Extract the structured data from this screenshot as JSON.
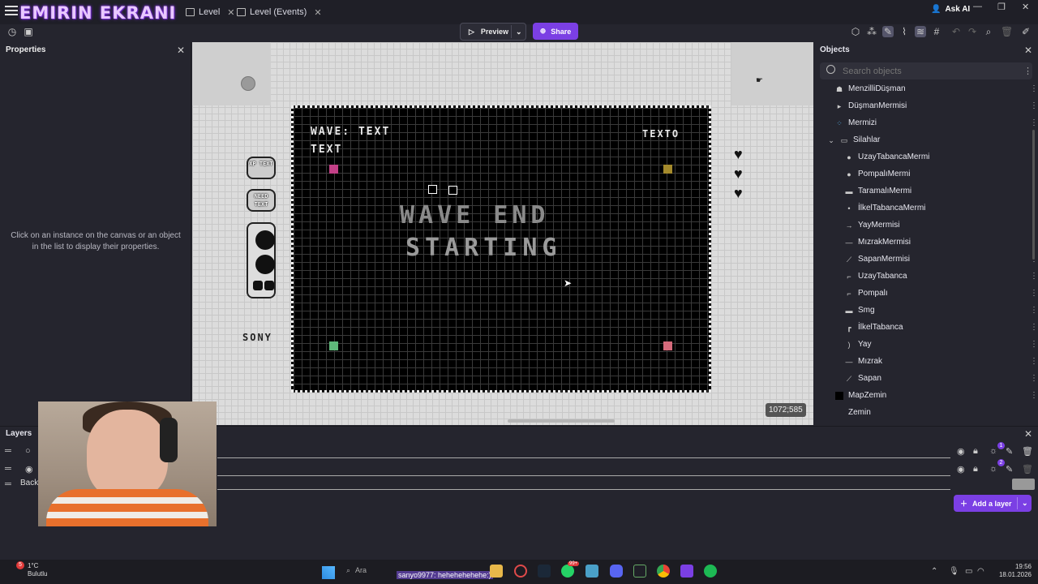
{
  "overlay_title": "EMIRIN EKRANI",
  "tabs": [
    {
      "label": "Level"
    },
    {
      "label": "Level (Events)"
    }
  ],
  "ask_ai": "Ask AI",
  "toolbar": {
    "preview": "Preview",
    "share": "Share"
  },
  "properties": {
    "title": "Properties",
    "hint": "Click on an instance on the canvas or an object in the list to display their properties."
  },
  "game": {
    "wave_text": "WAVE: TEXT",
    "text": "TEXT",
    "texto": "TEXTO",
    "wave_end": "WAVE END",
    "starting": "STARTING",
    "xp_text": "XP TEXT",
    "need_text": "NEED TEXT",
    "sony": "SONY"
  },
  "coords_readout": "1072;585",
  "objects": {
    "title": "Objects",
    "search_placeholder": "Search objects",
    "items": [
      {
        "label": "MenzilliDüşman",
        "icon": "enemy-icon"
      },
      {
        "label": "DüşmanMermisi",
        "icon": "play-icon"
      },
      {
        "label": "Mermizi",
        "icon": "bullet-icon"
      },
      {
        "label": "Silahlar",
        "icon": "folder-icon"
      },
      {
        "label": "UzayTabancaMermi",
        "icon": "dot-icon"
      },
      {
        "label": "PompalıMermi",
        "icon": "dot-icon"
      },
      {
        "label": "TaramalıMermi",
        "icon": "dash-icon"
      },
      {
        "label": "İlkelTabancaMermi",
        "icon": "small-dot-icon"
      },
      {
        "label": "YayMermisi",
        "icon": "arrow-icon"
      },
      {
        "label": "MızrakMermisi",
        "icon": "spear-icon"
      },
      {
        "label": "SapanMermisi",
        "icon": "sling-icon"
      },
      {
        "label": "UzayTabanca",
        "icon": "gun-icon"
      },
      {
        "label": "Pompalı",
        "icon": "shotgun-icon"
      },
      {
        "label": "Smg",
        "icon": "smg-icon"
      },
      {
        "label": "İlkelTabanca",
        "icon": "pistol-icon"
      },
      {
        "label": "Yay",
        "icon": "bow-icon"
      },
      {
        "label": "Mızrak",
        "icon": "spear-icon"
      },
      {
        "label": "Sapan",
        "icon": "sling-icon"
      },
      {
        "label": "MapZemin",
        "icon": "black-square-icon"
      },
      {
        "label": "Zemin",
        "icon": "none"
      }
    ]
  },
  "layers": {
    "title": "Layers",
    "back_label": "Back",
    "add_layer": "Add a layer",
    "badge1": "1",
    "badge2": "2"
  },
  "taskbar": {
    "weather_temp": "1°C",
    "weather_desc": "Bulutlu",
    "notif_count": "5",
    "search": "Ara",
    "chat_overlay": "sanyo9977: hehehehehehe:)",
    "badge": "99+",
    "time": "19:56",
    "date": "18.01.2026"
  },
  "colors": {
    "accent": "#7b3fe4",
    "panel": "#25252e",
    "canvas": "#dcdcdc"
  }
}
